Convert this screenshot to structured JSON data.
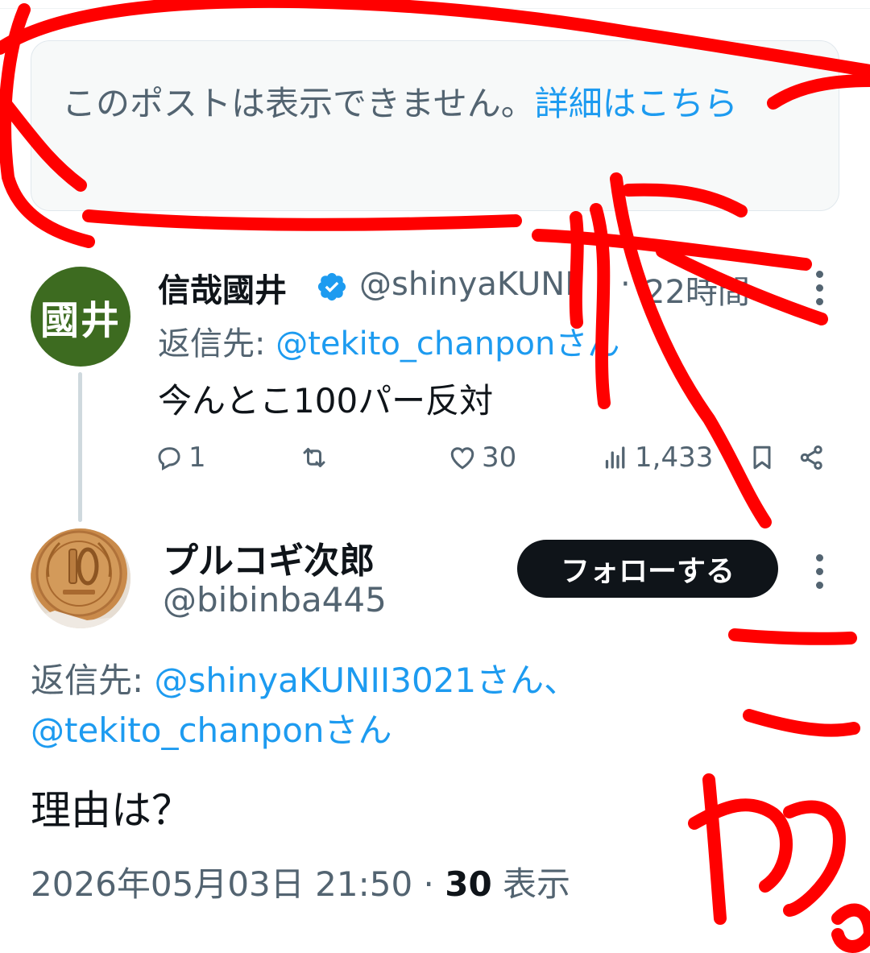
{
  "notice": {
    "text": "このポストは表示できません。",
    "link": "詳細はこちら"
  },
  "tweet1": {
    "avatar_text": "國井",
    "name": "信哉國井",
    "handle": "@shinyaKUNII",
    "separator": "·",
    "time": "22時間",
    "reply_label": "返信先: ",
    "reply_to": "@tekito_chanponさん",
    "text": "今んとこ100パー反対",
    "actions": {
      "reply_count": "1",
      "retweet_count": "",
      "like_count": "30",
      "view_count": "1,433"
    }
  },
  "tweet2": {
    "name": "プルコギ次郎",
    "handle": "@bibinba445",
    "follow_label": "フォローする",
    "reply_label": "返信先: ",
    "reply_to_1": "@shinyaKUNII3021さん、",
    "reply_to_2": "@tekito_chanponさん",
    "text": "理由は？",
    "datetime": "2026年05月03日 21:50",
    "separator": " · ",
    "views_count": "30",
    "views_label": " 表示"
  },
  "icons": {
    "verified": "verified-badge-icon",
    "reply": "speech-bubble-icon",
    "retweet": "repost-icon",
    "like": "heart-icon",
    "views": "bar-chart-icon",
    "bookmark": "bookmark-icon",
    "share": "share-icon",
    "more": "vertical-dots-icon"
  },
  "colors": {
    "accent": "#1d9bf0",
    "text": "#0f1419",
    "secondary": "#536471",
    "annotation": "#ff0000"
  },
  "annotation_text": "これ"
}
